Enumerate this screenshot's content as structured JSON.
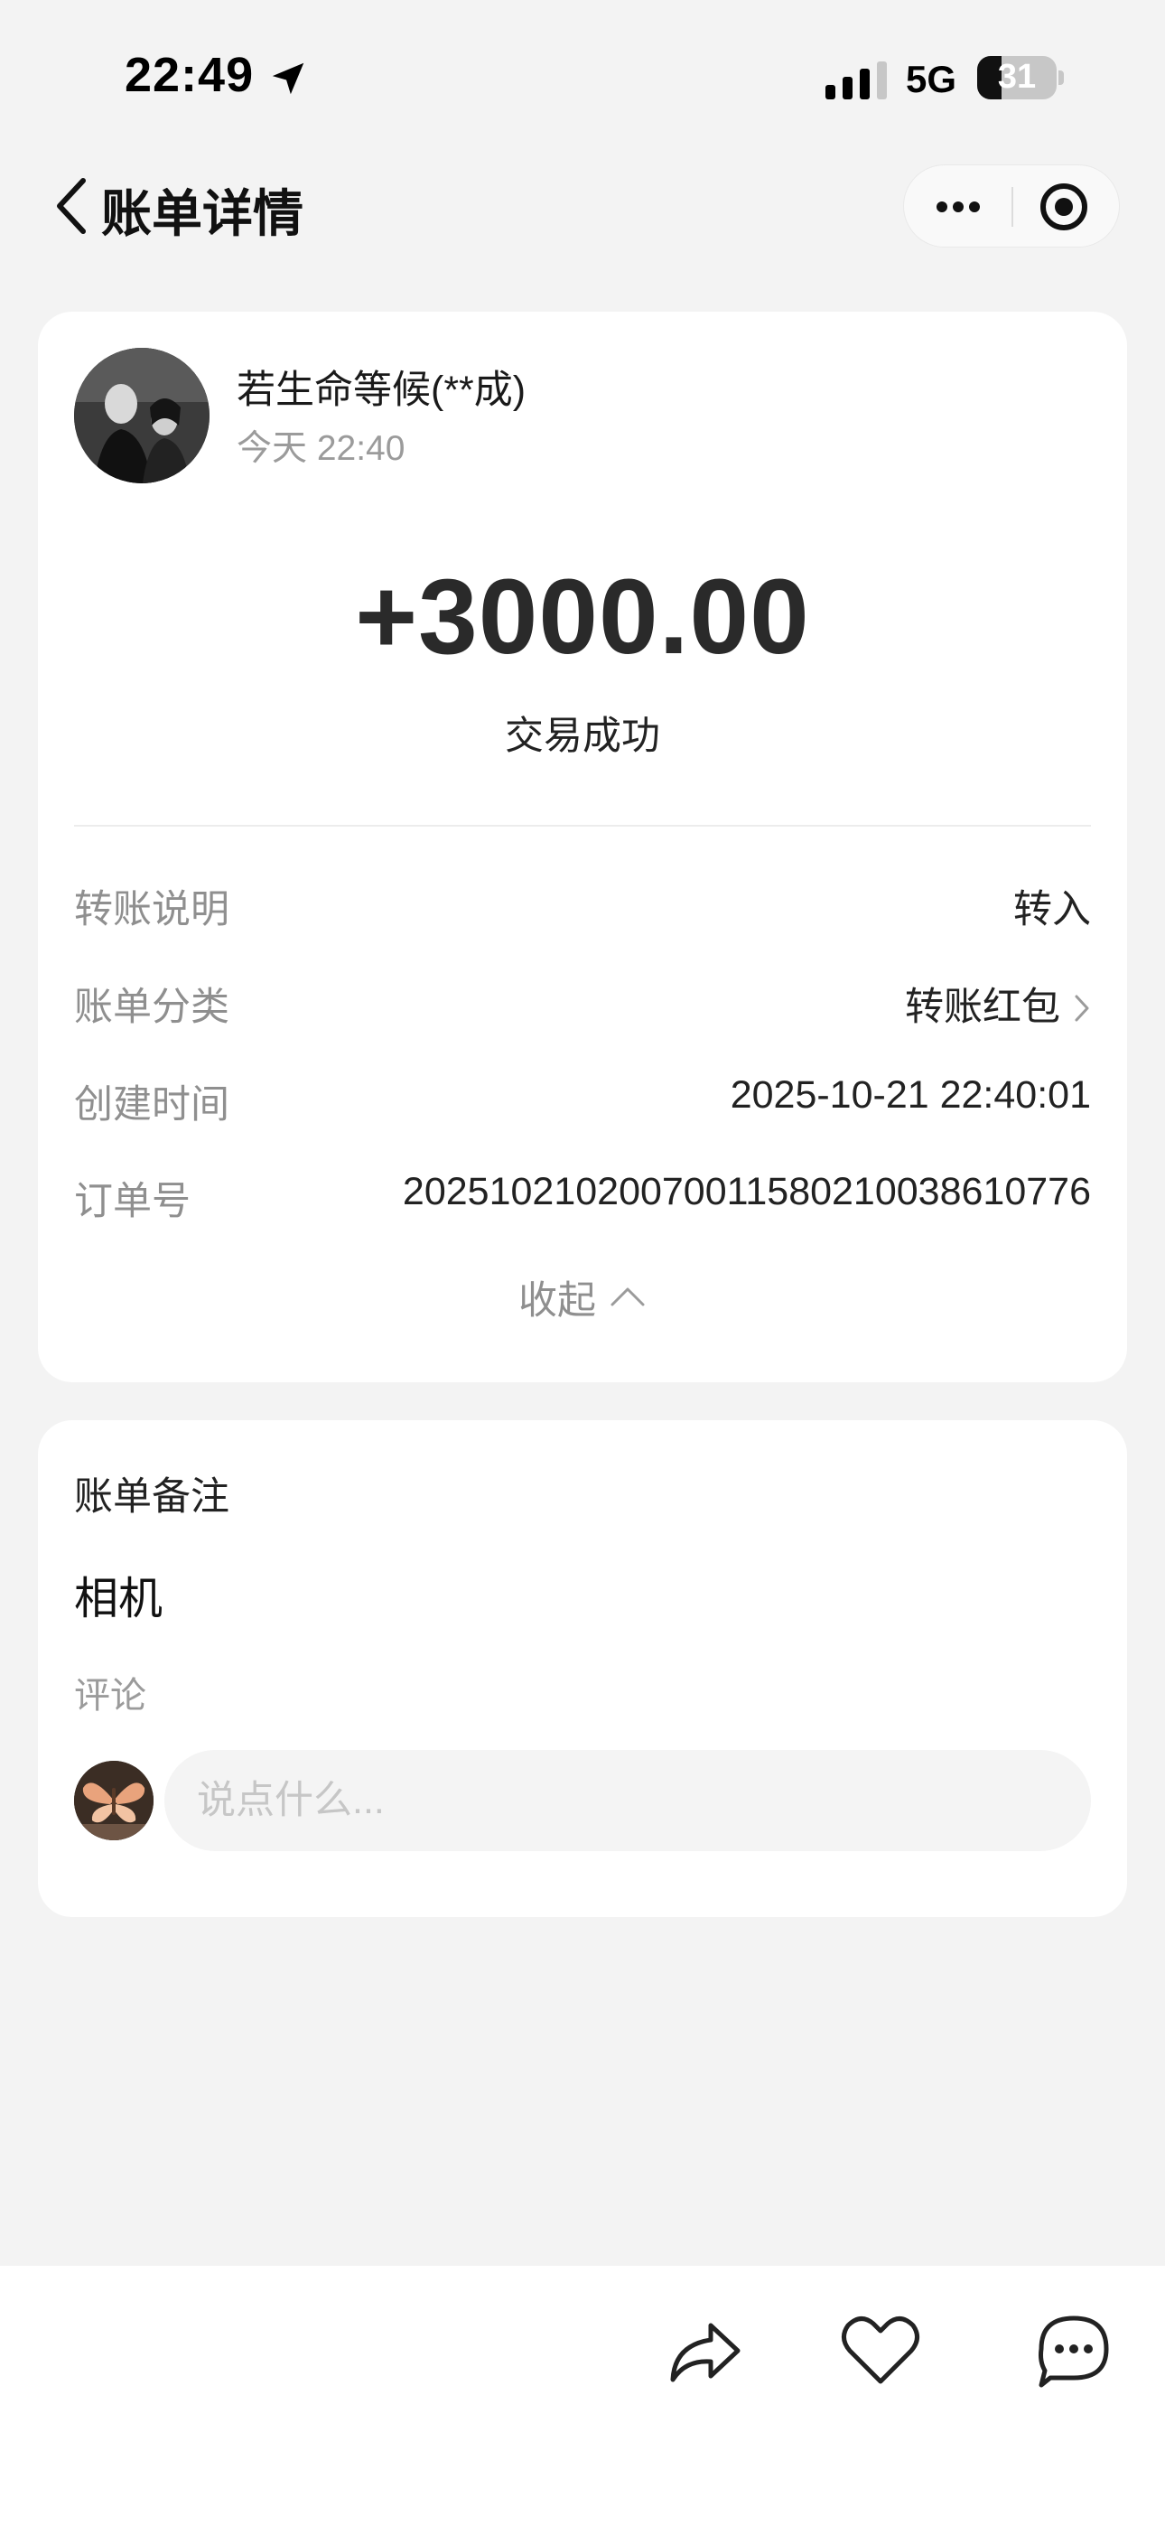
{
  "status_bar": {
    "time": "22:49",
    "network": "5G",
    "battery_level": "31",
    "battery_fraction": 0.31
  },
  "nav": {
    "title": "账单详情",
    "icons": [
      "back-chevron-icon",
      "more-dots-icon",
      "close-target-icon"
    ]
  },
  "transaction": {
    "payer_name": "若生命等候(**成)",
    "payer_time": "今天 22:40",
    "amount": "+3000.00",
    "status": "交易成功"
  },
  "details": {
    "rows": [
      {
        "label": "转账说明",
        "value": "转入"
      },
      {
        "label": "账单分类",
        "value": "转账红包"
      },
      {
        "label": "创建时间",
        "value": "2025-10-21 22:40:01"
      },
      {
        "label": "订单号",
        "value": "2025102102007001158021003861077­6"
      }
    ],
    "collapse_label": "收起"
  },
  "note": {
    "title": "账单备注",
    "content": "相机",
    "comment_label": "评论",
    "comment_placeholder": "说点什么..."
  },
  "bottom_actions": [
    "share-icon",
    "heart-icon",
    "comment-icon"
  ],
  "colors": {
    "background": "#f3f3f3",
    "card": "#ffffff",
    "muted_text": "#8f8f8f"
  }
}
